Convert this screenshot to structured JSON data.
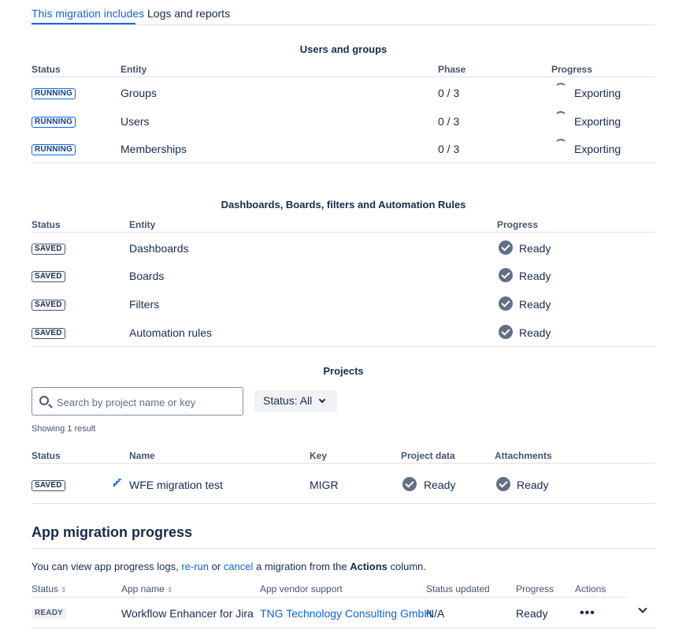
{
  "tabs": [
    {
      "label": "This migration includes",
      "active": true
    },
    {
      "label": "Logs and reports",
      "active": false
    }
  ],
  "users_groups": {
    "title": "Users and groups",
    "headers": {
      "status": "Status",
      "entity": "Entity",
      "phase": "Phase",
      "progress": "Progress"
    },
    "rows": [
      {
        "status": "RUNNING",
        "entity": "Groups",
        "phase": "0 / 3",
        "progress": "Exporting"
      },
      {
        "status": "RUNNING",
        "entity": "Users",
        "phase": "0 / 3",
        "progress": "Exporting"
      },
      {
        "status": "RUNNING",
        "entity": "Memberships",
        "phase": "0 / 3",
        "progress": "Exporting"
      }
    ]
  },
  "dashboards": {
    "title": "Dashboards, Boards, filters and Automation Rules",
    "headers": {
      "status": "Status",
      "entity": "Entity",
      "progress": "Progress"
    },
    "rows": [
      {
        "status": "SAVED",
        "entity": "Dashboards",
        "progress": "Ready"
      },
      {
        "status": "SAVED",
        "entity": "Boards",
        "progress": "Ready"
      },
      {
        "status": "SAVED",
        "entity": "Filters",
        "progress": "Ready"
      },
      {
        "status": "SAVED",
        "entity": "Automation rules",
        "progress": "Ready"
      }
    ]
  },
  "projects": {
    "title": "Projects",
    "search_placeholder": "Search by project name or key",
    "status_filter": "Status: All",
    "result_count": "Showing 1 result",
    "headers": {
      "status": "Status",
      "name": "Name",
      "key": "Key",
      "project_data": "Project data",
      "attachments": "Attachments"
    },
    "rows": [
      {
        "status": "SAVED",
        "name": "WFE migration test",
        "key": "MIGR",
        "project_data": "Ready",
        "attachments": "Ready"
      }
    ]
  },
  "apps": {
    "title": "App migration progress",
    "info_prefix": "You can view app progress logs, ",
    "info_rerun": "re-run",
    "info_or": " or ",
    "info_cancel": "cancel",
    "info_middle": " a migration from the ",
    "info_bold": "Actions",
    "info_suffix": " column.",
    "headers": {
      "status": "Status",
      "app_name": "App name",
      "vendor": "App vendor support",
      "updated": "Status updated",
      "progress": "Progress",
      "actions": "Actions"
    },
    "rows": [
      {
        "status": "READY",
        "app_name": "Workflow Enhancer for Jira",
        "vendor": "TNG Technology Consulting GmbH",
        "updated": "N/A",
        "progress": "Ready",
        "actions": "•••"
      }
    ]
  },
  "colors": {
    "accent": "#0c66e4",
    "text": "#172b4d",
    "subtle": "#44546f"
  }
}
